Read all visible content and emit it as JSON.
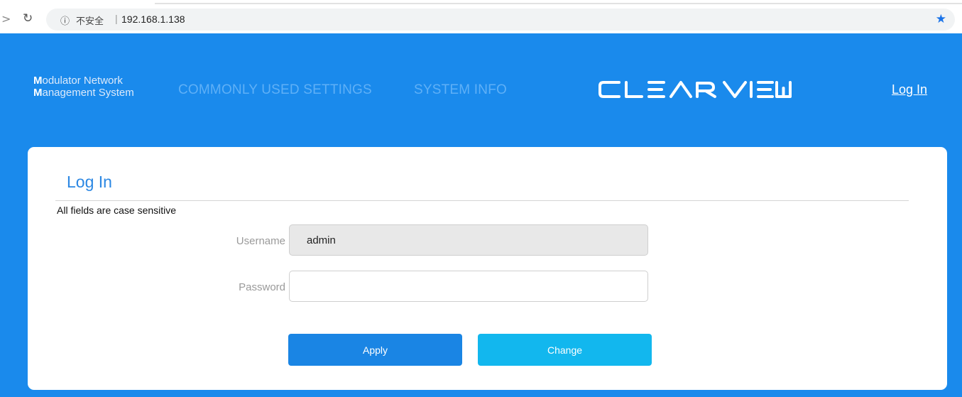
{
  "browser": {
    "forward_icon": "forward-arrow-icon",
    "reload_icon": "reload-icon",
    "info_icon": "info-icon",
    "security_label": "不安全",
    "separator": "|",
    "url": "192.168.1.138",
    "bookmark_icon": "star-icon"
  },
  "header": {
    "brand_line1_initial": "M",
    "brand_line1_rest": "odulator Network",
    "brand_line2_initial": "M",
    "brand_line2_rest": "anagement System",
    "nav_items": [
      "COMMONLY USED SETTINGS",
      "SYSTEM INFO"
    ],
    "logo_text": "ClearView",
    "login_link": "Log In"
  },
  "login_form": {
    "title": "Log In",
    "note": "All fields are case sensitive",
    "username_label": "Username",
    "username_value": "admin",
    "password_label": "Password",
    "password_value": "",
    "apply_label": "Apply",
    "change_label": "Change"
  },
  "colors": {
    "header_bg": "#1a8aec",
    "title_blue": "#2b87e3",
    "apply_bg": "#1a85e4",
    "change_bg": "#12b7ee"
  }
}
